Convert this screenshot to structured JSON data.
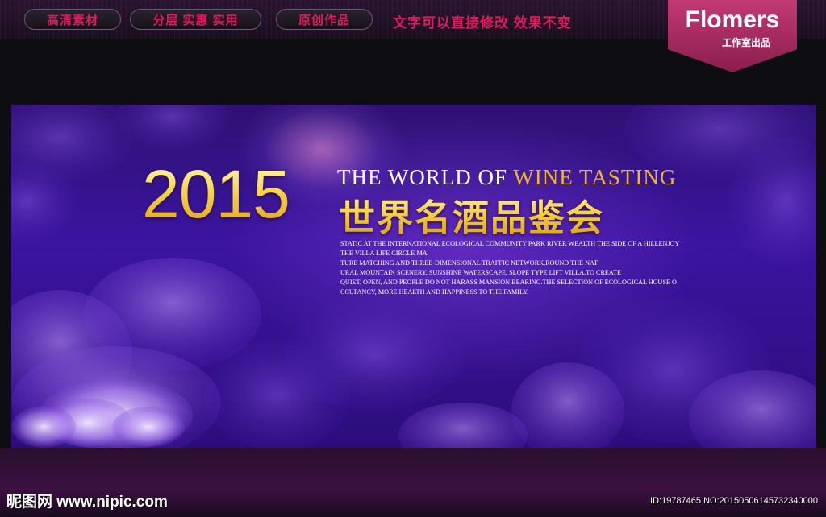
{
  "header": {
    "tabs": [
      {
        "label": "高清素材"
      },
      {
        "label": "分层 实惠 实用"
      },
      {
        "label": "原创作品"
      }
    ],
    "tagline": "文字可以直接修改  效果不变",
    "brand": {
      "name": "Flomers",
      "sub": "工作室出品"
    }
  },
  "banner": {
    "year": "2015",
    "title_en_part1": "THE WORLD OF ",
    "title_en_part2": "WINE TASTING",
    "title_cn": "世界名酒品鉴会",
    "body_lines": [
      "STATIC AT THE INTERNATIONAL ECOLOGICAL COMMUNITY PARK RIVER WEALTH THE SIDE OF A HILLENJOY",
      "THE VILLA LIFE CIRCLE MA",
      "TURE MATCHING AND THREE-DIMENSIONAL TRAFFIC NETWORK,ROUND THE NAT",
      "URAL MOUNTAIN SCENERY, SUNSHINE WATERSCAPE, SLOPE TYPE LIFT VILLA,TO CREATE",
      "QUIET, OPEN, AND PEOPLE DO NOT HARASS MANSION BEARING.THE SELECTION OF ECOLOGICAL HOUSE O",
      "CCUPANCY, MORE HEALTH AND HAPPINESS TO THE FAMILY."
    ]
  },
  "watermark": {
    "site": "昵图网 www.nipic.com",
    "id_text": "ID:19787465 NO:20150506145732340000"
  },
  "colors": {
    "accent_pink": "#e1195f",
    "brand_magenta": "#b0306a",
    "gold": "#f6cf3a",
    "banner_purple": "#3b14a0"
  }
}
